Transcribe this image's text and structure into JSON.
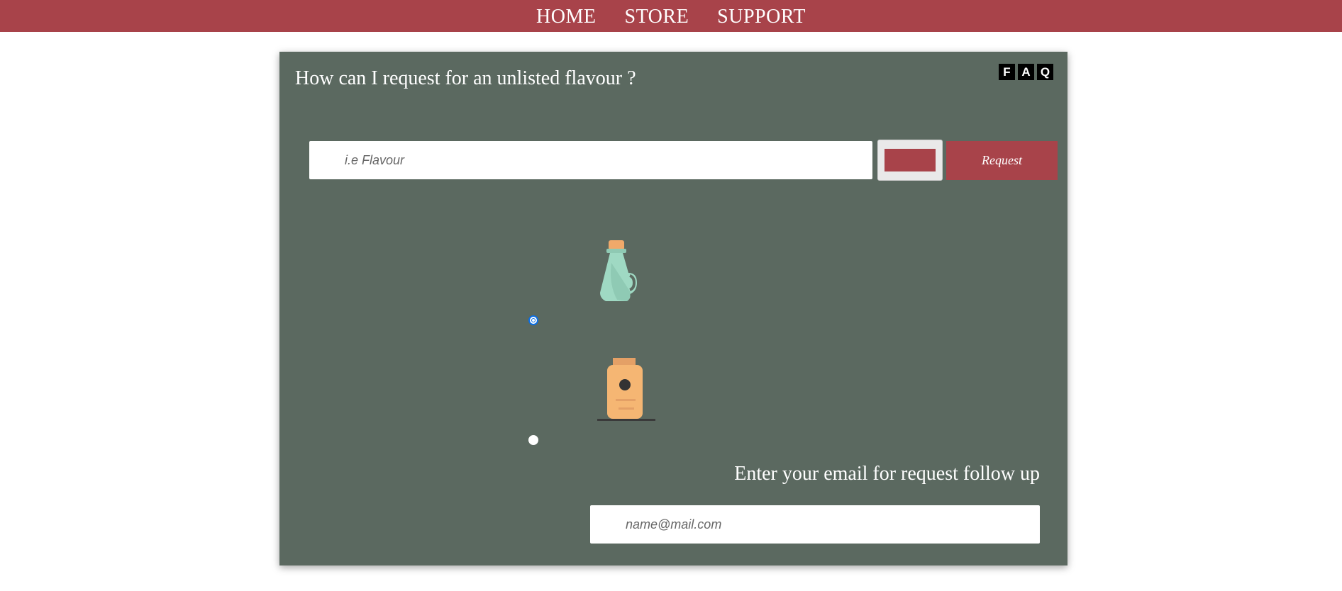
{
  "nav": {
    "items": [
      {
        "label": "HOME"
      },
      {
        "label": "STORE"
      },
      {
        "label": "SUPPORT"
      }
    ]
  },
  "faq": {
    "question": "How can I request for an unlisted flavour ?",
    "badge_letters": [
      "F",
      "A",
      "Q"
    ]
  },
  "request_form": {
    "flavour_placeholder": "i.e Flavour",
    "flavour_value": "",
    "color_value": "#a8434a",
    "request_label": "Request",
    "options": [
      {
        "icon": "jug-bottle-icon",
        "selected": true
      },
      {
        "icon": "jar-bottle-icon",
        "selected": false
      }
    ],
    "email_label": "Enter your email for request follow up",
    "email_placeholder": "name@mail.com",
    "email_value": ""
  },
  "colors": {
    "accent": "#a8434a",
    "panel": "#5b6960",
    "jug": "#9fd9c3",
    "cork": "#f0a96a",
    "jar": "#f5b673"
  }
}
